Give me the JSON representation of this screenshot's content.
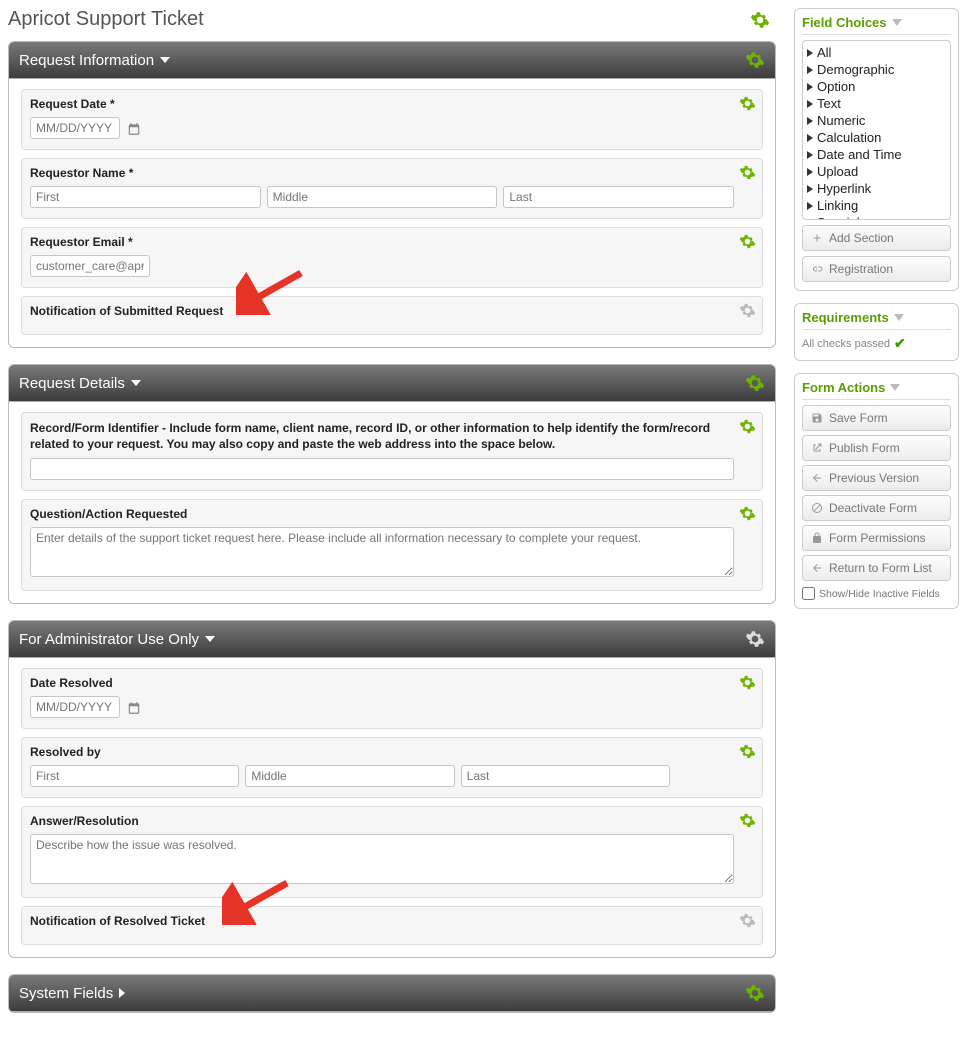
{
  "page": {
    "title": "Apricot Support Ticket"
  },
  "sections": {
    "reqInfo": {
      "title": "Request Information"
    },
    "reqDetails": {
      "title": "Request Details"
    },
    "admin": {
      "title": "For Administrator Use Only"
    },
    "system": {
      "title": "System Fields"
    }
  },
  "fields": {
    "requestDate": {
      "label": "Request Date *",
      "placeholder": "MM/DD/YYYY"
    },
    "requestorName": {
      "label": "Requestor Name *",
      "first": "First",
      "middle": "Middle",
      "last": "Last"
    },
    "requestorEmail": {
      "label": "Requestor Email *",
      "value": "customer_care@apricot"
    },
    "notifSubmitted": {
      "label": "Notification of Submitted Request"
    },
    "recordId": {
      "label": "Record/Form Identifier - Include form name, client name, record ID, or other information to help identify the form/record related to your request. You may also copy and paste the web address into the space below."
    },
    "question": {
      "label": "Question/Action Requested",
      "placeholder": "Enter details of the support ticket request here. Please include all information necessary to complete your request."
    },
    "dateResolved": {
      "label": "Date Resolved",
      "placeholder": "MM/DD/YYYY"
    },
    "resolvedBy": {
      "label": "Resolved by",
      "first": "First",
      "middle": "Middle",
      "last": "Last"
    },
    "answer": {
      "label": "Answer/Resolution",
      "placeholder": "Describe how the issue was resolved."
    },
    "notifResolved": {
      "label": "Notification of Resolved Ticket"
    }
  },
  "sidebar": {
    "fieldChoices": {
      "title": "Field Choices",
      "items": [
        "All",
        "Demographic",
        "Option",
        "Text",
        "Numeric",
        "Calculation",
        "Date and Time",
        "Upload",
        "Hyperlink",
        "Linking",
        "Special"
      ]
    },
    "addSection": "Add Section",
    "registration": "Registration",
    "requirements": {
      "title": "Requirements",
      "status": "All checks passed"
    },
    "formActions": {
      "title": "Form Actions",
      "save": "Save Form",
      "publish": "Publish Form",
      "prev": "Previous Version",
      "deactivate": "Deactivate Form",
      "perms": "Form Permissions",
      "back": "Return to Form List",
      "showHide": "Show/Hide Inactive Fields"
    }
  }
}
